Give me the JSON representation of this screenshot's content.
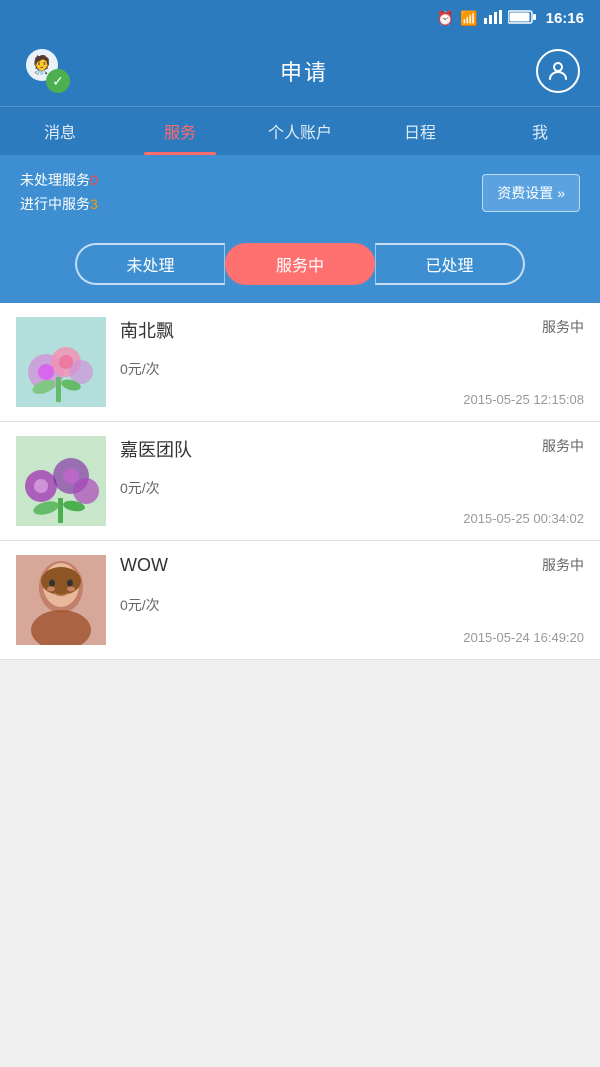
{
  "statusBar": {
    "time": "16:16",
    "icons": [
      "clock",
      "wifi",
      "signal",
      "battery"
    ]
  },
  "header": {
    "title": "申请",
    "profileIcon": "user"
  },
  "navTabs": [
    {
      "label": "消息",
      "active": false,
      "id": "messages"
    },
    {
      "label": "服务",
      "active": true,
      "id": "service"
    },
    {
      "label": "个人账户",
      "active": false,
      "id": "account"
    },
    {
      "label": "日程",
      "active": false,
      "id": "schedule"
    },
    {
      "label": "我",
      "active": false,
      "id": "me"
    }
  ],
  "summary": {
    "line1_prefix": "未处理服务",
    "line1_count": "0",
    "line2_prefix": "进行中服务",
    "line2_count": "3",
    "settingsLabel": "资费设置",
    "settingsArrow": "»"
  },
  "filterTabs": [
    {
      "label": "未处理",
      "active": false,
      "id": "pending"
    },
    {
      "label": "服务中",
      "active": true,
      "id": "inservice"
    },
    {
      "label": "已处理",
      "active": false,
      "id": "done"
    }
  ],
  "listItems": [
    {
      "name": "南北飘",
      "price": "0元/次",
      "status": "服务中",
      "date": "2015-05-25 12:15:08",
      "imgType": "flowers1"
    },
    {
      "name": "嘉医团队",
      "price": "0元/次",
      "status": "服务中",
      "date": "2015-05-25 00:34:02",
      "imgType": "flowers2"
    },
    {
      "name": "WOW",
      "price": "0元/次",
      "status": "服务中",
      "date": "2015-05-24 16:49:20",
      "imgType": "person"
    }
  ],
  "colors": {
    "headerBg": "#2c7bbf",
    "activeTab": "#ff6b6b",
    "inServiceBtn": "#ff7070",
    "summaryBg": "#3d8fd1",
    "countZero": "#ff4444",
    "countThree": "#ff9900"
  }
}
